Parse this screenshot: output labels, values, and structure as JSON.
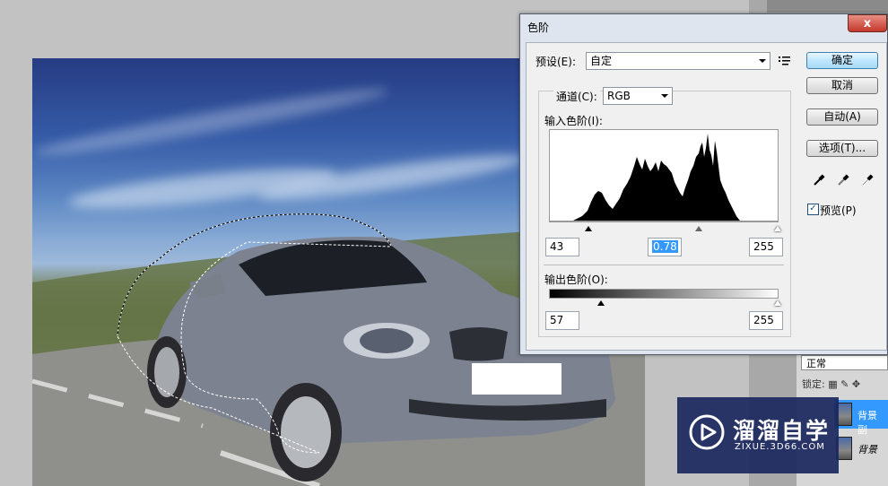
{
  "dialog": {
    "title": "色阶",
    "close_symbol": "x",
    "preset_label": "预设(E):",
    "preset_value": "自定",
    "channel_label": "通道(C):",
    "channel_value": "RGB",
    "input_levels_label": "输入色阶(I):",
    "input_black": "43",
    "input_gamma": "0.78",
    "input_white": "255",
    "output_levels_label": "输出色阶(O):",
    "output_black": "57",
    "output_white": "255",
    "buttons": {
      "ok": "确定",
      "cancel": "取消",
      "auto": "自动(A)",
      "options": "选项(T)..."
    },
    "preview_label": "预览(P)",
    "preview_checked": true,
    "histogram_icon": "histogram-menu-icon",
    "eyedroppers": [
      "black-eyedropper-icon",
      "gray-eyedropper-icon",
      "white-eyedropper-icon"
    ]
  },
  "layers_panel": {
    "blend_mode": "正常",
    "lock_label": "锁定:",
    "layers": [
      {
        "name": "背景 副",
        "selected": true
      },
      {
        "name": "背景",
        "selected": false
      }
    ]
  },
  "watermark": {
    "title": "溜溜自学",
    "subtitle": "ZIXUE.3D66.COM"
  },
  "colors": {
    "dialog_bg": "#f0f0f0",
    "title_bar": "#dfe5ee",
    "selection_highlight": "#3399ff",
    "watermark_bg": "#1c285f"
  }
}
